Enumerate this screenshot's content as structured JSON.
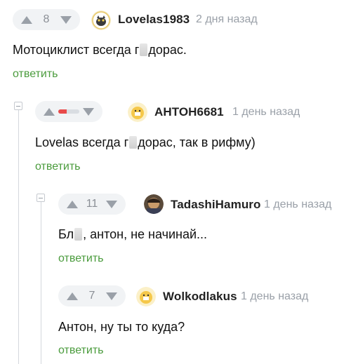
{
  "comments": [
    {
      "rating": "8",
      "author": "Lovelas1983",
      "time": "2 дня назад",
      "text_before": "Мотоциклист всегда г",
      "text_after": "дорас.",
      "reply": "ответить"
    },
    {
      "author": "АНТОН6681",
      "time": "1 день назад",
      "text_before": "Lovelas всегда г",
      "text_after": "дорас, так в рифму)",
      "reply": "ответить"
    },
    {
      "rating": "11",
      "author": "TadashiHamuro",
      "time": "1 день назад",
      "text_before": "Бл",
      "text_after": ", антон, не начинай...",
      "reply": "ответить"
    },
    {
      "rating": "7",
      "author": "Wolkodlakus",
      "time": "1 день назад",
      "text": "Антон, ну ты то куда?",
      "reply": "ответить"
    }
  ],
  "colors": {
    "accent_green": "#4a9b3c",
    "negative_red": "#e84a4a",
    "muted_grey": "#9aa0a8"
  }
}
